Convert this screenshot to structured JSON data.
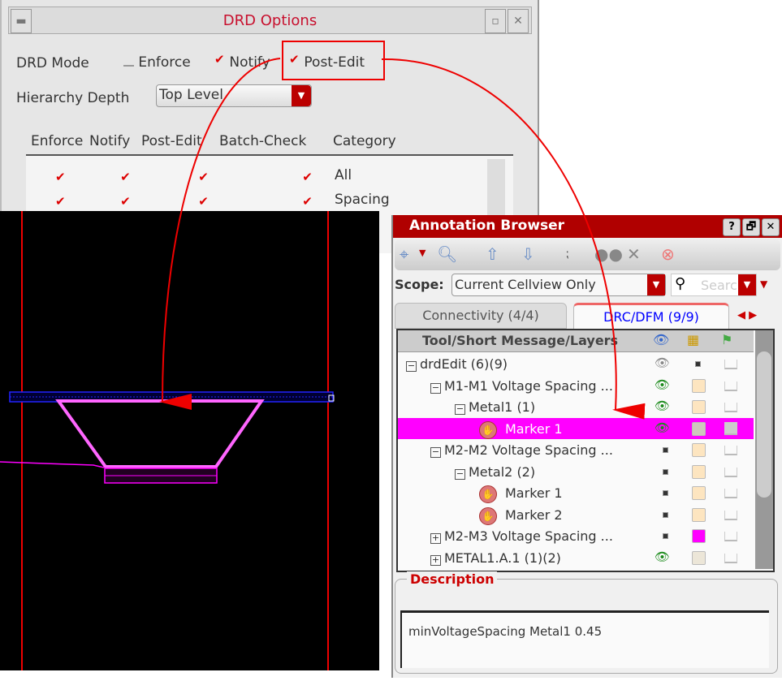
{
  "drd": {
    "title": "DRD Options",
    "mode_label": "DRD Mode",
    "modes": [
      {
        "label": "Enforce",
        "checked": false
      },
      {
        "label": "Notify",
        "checked": true
      },
      {
        "label": "Post-Edit",
        "checked": true
      }
    ],
    "hier_label": "Hierarchy Depth",
    "hier_value": "Top Level",
    "columns": [
      "Enforce",
      "Notify",
      "Post-Edit",
      "Batch-Check",
      "Category"
    ],
    "rows": [
      {
        "category": "All",
        "checks": [
          true,
          true,
          true,
          true
        ]
      },
      {
        "category": "Spacing",
        "checks": [
          true,
          true,
          true,
          true
        ]
      }
    ]
  },
  "ab": {
    "title": "Annotation Browser",
    "help": "?",
    "restore": "🗗",
    "close": "✕",
    "scope_label": "Scope:",
    "scope_value": "Current Cellview Only",
    "search_placeholder": "Search",
    "tabs": [
      {
        "label": "Connectivity (4/4)",
        "active": false
      },
      {
        "label": "DRC/DFM (9/9)",
        "active": true
      }
    ],
    "tree_header": "Tool/Short Message/Layers",
    "tree": [
      {
        "label": "drdEdit (6)(9)",
        "indent": 0,
        "exp": "−",
        "vis": "eye-gray",
        "color": "dot"
      },
      {
        "label": "M1-M1 Voltage Spacing ...",
        "indent": 1,
        "exp": "−",
        "vis": "eye",
        "color": "#fde5c0"
      },
      {
        "label": "Metal1 (1)",
        "indent": 2,
        "exp": "−",
        "vis": "eye",
        "color": "#fde5c0"
      },
      {
        "label": "Marker 1",
        "indent": 3,
        "marker": true,
        "vis": "eye",
        "color": "#cfc6bd",
        "selected": true
      },
      {
        "label": "M2-M2 Voltage Spacing ...",
        "indent": 1,
        "exp": "−",
        "vis": "dot",
        "color": "#fde5c0"
      },
      {
        "label": "Metal2 (2)",
        "indent": 2,
        "exp": "−",
        "vis": "dot",
        "color": "#fde5c0"
      },
      {
        "label": "Marker 1",
        "indent": 3,
        "marker": true,
        "vis": "dot",
        "color": "#fde5c0"
      },
      {
        "label": "Marker 2",
        "indent": 3,
        "marker": true,
        "vis": "dot",
        "color": "#fde5c0"
      },
      {
        "label": "M2-M3 Voltage Spacing ...",
        "indent": 1,
        "exp": "+",
        "vis": "dot",
        "color": "#ff00ff"
      },
      {
        "label": "METAL1.A.1 (1)(2)",
        "indent": 1,
        "exp": "+",
        "vis": "eye",
        "color": "#ece6d8"
      }
    ],
    "desc_label": "Description",
    "desc_text": "minVoltageSpacing Metal1 0.45"
  }
}
